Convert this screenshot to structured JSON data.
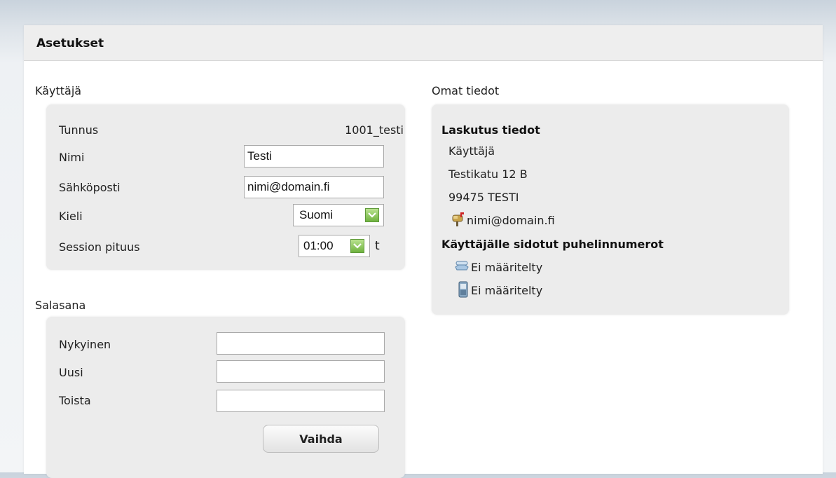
{
  "window": {
    "title": "Asetukset"
  },
  "user_section": {
    "title": "Käyttäjä",
    "username_label": "Tunnus",
    "username_value": "1001_testi",
    "name_label": "Nimi",
    "name_value": "Testi",
    "email_label": "Sähköposti",
    "email_value": "nimi@domain.fi",
    "language_label": "Kieli",
    "language_value": "Suomi",
    "session_label": "Session pituus",
    "session_value": "01:00",
    "session_unit": "t"
  },
  "password_section": {
    "title": "Salasana",
    "current_label": "Nykyinen",
    "new_label": "Uusi",
    "repeat_label": "Toista",
    "change_button": "Vaihda"
  },
  "own_info": {
    "title": "Omat tiedot",
    "billing_heading": "Laskutus tiedot",
    "billing_name": "Käyttäjä",
    "billing_street": "Testikatu 12 B",
    "billing_city": "99475 TESTI",
    "billing_email": "nimi@domain.fi",
    "phones_heading": "Käyttäjälle sidotut puhelinnumerot",
    "landline_value": "Ei määritelty",
    "mobile_value": "Ei määritelty"
  },
  "icons": {
    "email": "mailbox-icon",
    "landline": "landline-phone-icon",
    "mobile": "mobile-phone-icon",
    "select_arrow": "chevron-down-icon"
  },
  "colors": {
    "accent_green": "#6fb23f",
    "panel_bg": "#ececec"
  }
}
